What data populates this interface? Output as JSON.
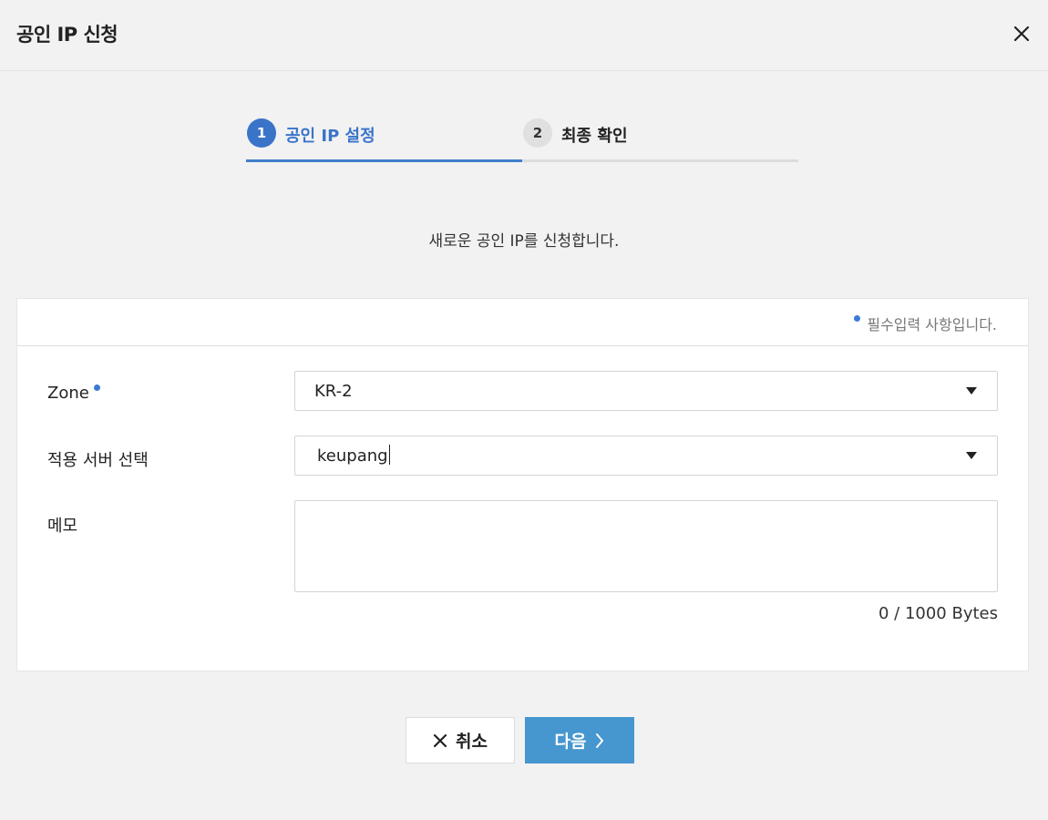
{
  "modal": {
    "title": "공인 IP 신청"
  },
  "stepper": {
    "steps": [
      {
        "number": "1",
        "label": "공인 IP 설정",
        "active": true
      },
      {
        "number": "2",
        "label": "최종 확인",
        "active": false
      }
    ]
  },
  "intro": "새로운 공인 IP를 신청합니다.",
  "form": {
    "required_note": "필수입력 사항입니다.",
    "fields": {
      "zone": {
        "label": "Zone",
        "value": "KR-2",
        "required": true
      },
      "server": {
        "label": "적용 서버 선택",
        "value": "keupang",
        "required": false
      },
      "memo": {
        "label": "메모",
        "value": "",
        "placeholder": ""
      }
    },
    "byte_counter": "0 / 1000 Bytes"
  },
  "footer": {
    "cancel_label": "취소",
    "next_label": "다음"
  },
  "colors": {
    "accent": "#3a74c9",
    "primary_button": "#4696cf",
    "required_dot": "#3a7bd5"
  },
  "icons": {
    "close": "close-icon",
    "caret": "caret-down-icon",
    "cancel": "x-icon",
    "next": "chevron-right-icon"
  }
}
